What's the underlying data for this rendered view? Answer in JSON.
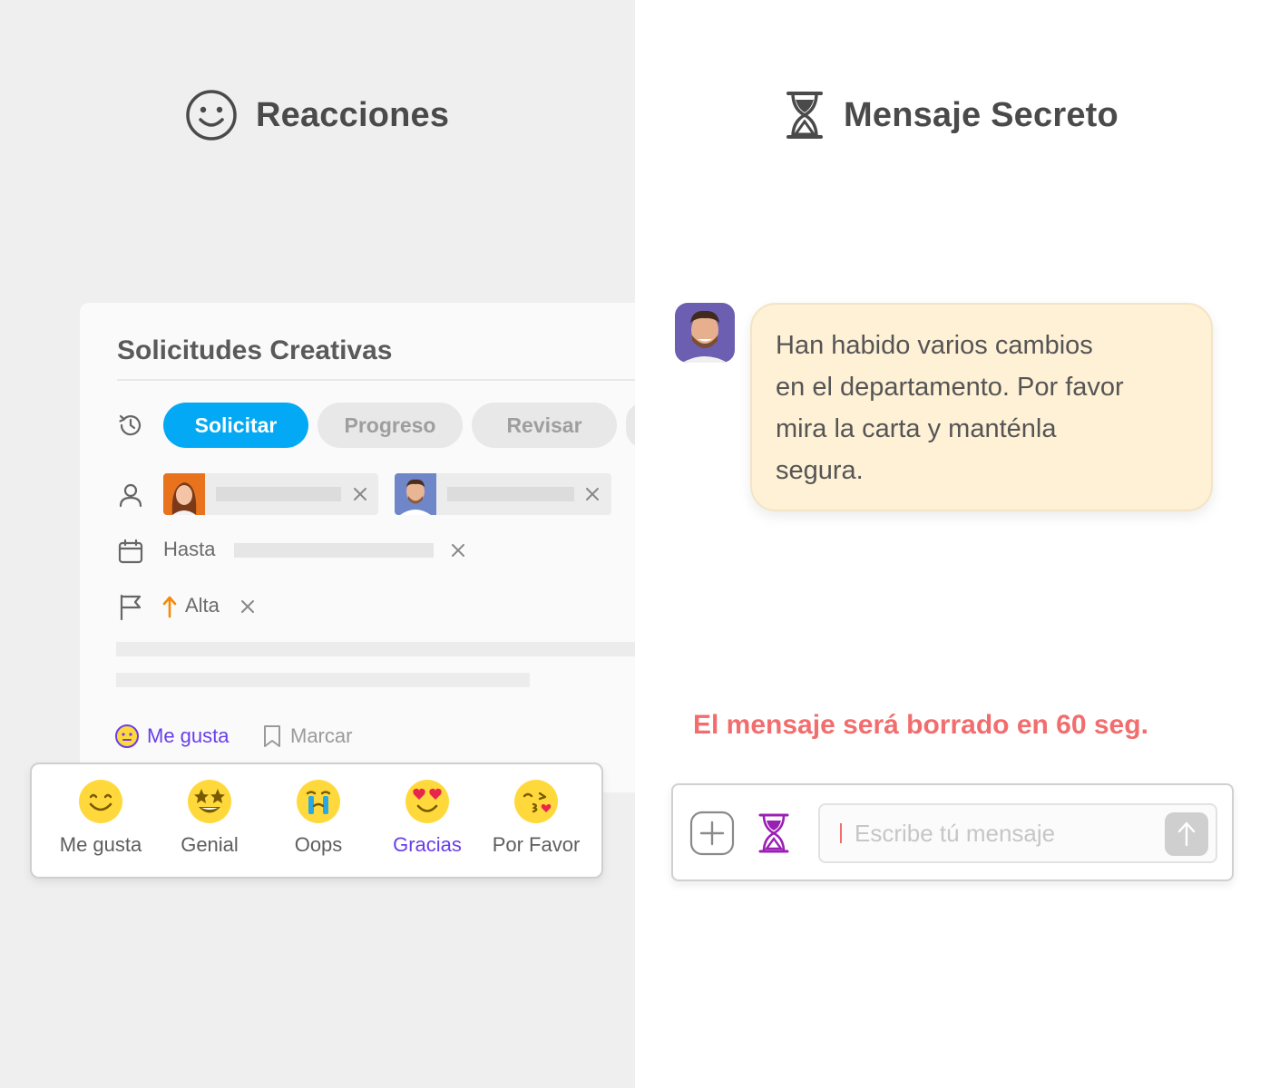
{
  "reacciones": {
    "title": "Reacciones",
    "icon": "smiley-icon"
  },
  "secreto": {
    "title": "Mensaje Secreto",
    "icon": "hourglass-icon"
  },
  "card": {
    "title": "Solicitudes Creativas",
    "tabs": [
      {
        "label": "Solicitar",
        "active": true
      },
      {
        "label": "Progreso",
        "active": false
      },
      {
        "label": "Revisar",
        "active": false
      }
    ],
    "due_label": "Hasta",
    "priority_label": "Alta",
    "actions": {
      "like": "Me gusta",
      "bookmark": "Marcar"
    }
  },
  "reactions": [
    {
      "label": "Me gusta",
      "icon": "smile-emoji",
      "active": false
    },
    {
      "label": "Genial",
      "icon": "star-eyes-emoji",
      "active": false
    },
    {
      "label": "Oops",
      "icon": "crying-emoji",
      "active": false
    },
    {
      "label": "Gracias",
      "icon": "heart-eyes-emoji",
      "active": true
    },
    {
      "label": "Por Favor",
      "icon": "kiss-emoji",
      "active": false
    }
  ],
  "message": {
    "lines": [
      "Han habido varios cambios",
      "en el departamento. Por favor",
      "mira la carta y manténla",
      "segura."
    ]
  },
  "warning": "El mensaje será borrado en 60 seg.",
  "composer": {
    "placeholder": "Escribe tú mensaje"
  },
  "colors": {
    "accent": "#03a9f4",
    "purple": "#6a3ee8",
    "warning": "#f26d6d",
    "bubble": "#fff1d6",
    "hourglass": "#9b1fb5"
  }
}
